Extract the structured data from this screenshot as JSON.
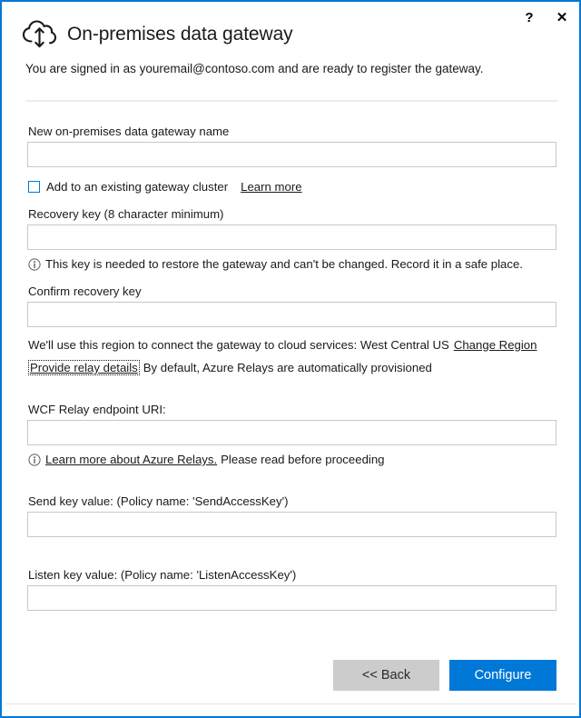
{
  "window": {
    "accent_color": "#0078d7",
    "border_color": "#0078d7",
    "help_label": "?",
    "close_label": "✕"
  },
  "header": {
    "icon": "cloud-upload-download-icon",
    "title": "On-premises data gateway",
    "subtitle": "You are signed in as youremail@contoso.com and are ready to register the gateway."
  },
  "form": {
    "gateway_name": {
      "label": "New on-premises data gateway name",
      "value": "",
      "placeholder": ""
    },
    "cluster_checkbox": {
      "label": "Add to an existing gateway cluster",
      "checked": false,
      "learn_more": "Learn more"
    },
    "recovery_key": {
      "label": "Recovery key (8 character minimum)",
      "value": "",
      "placeholder": "",
      "note": "This key is needed to restore the gateway and can't be changed. Record it in a safe place."
    },
    "confirm_recovery_key": {
      "label": "Confirm recovery key",
      "value": "",
      "placeholder": ""
    },
    "region": {
      "text": "We'll use this region to connect the gateway to cloud services: West Central US",
      "region_name": "West Central US",
      "change_link": "Change Region"
    },
    "relay": {
      "link": "Provide relay details",
      "text": "By default, Azure Relays are automatically provisioned"
    },
    "wcf_relay_uri": {
      "label": "WCF Relay endpoint URI:",
      "value": "",
      "placeholder": "",
      "note_link": "Learn more about Azure Relays.",
      "note_text": "Please read before proceeding"
    },
    "send_key": {
      "label": "Send key value: (Policy name: 'SendAccessKey')",
      "value": "",
      "placeholder": ""
    },
    "listen_key": {
      "label": "Listen key value: (Policy name: 'ListenAccessKey')",
      "value": "",
      "placeholder": ""
    }
  },
  "footer": {
    "back_label": "<< Back",
    "configure_label": "Configure"
  }
}
